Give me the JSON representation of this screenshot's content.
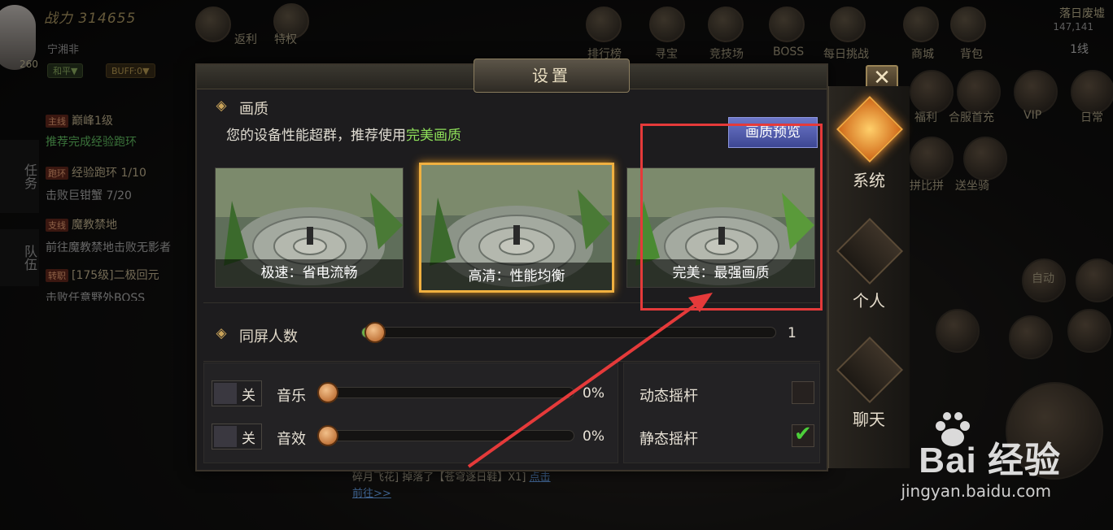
{
  "background_hud": {
    "power": "战力 314655",
    "player_name": "宁湘非",
    "level": "260",
    "pill_mode": "和平▼",
    "pill_buff": "BUFF:0▼",
    "top_icons": [
      "返利",
      "特权",
      "排行榜",
      "寻宝",
      "竞技场",
      "BOSS",
      "每日挑战",
      "商城",
      "背包"
    ],
    "vip_label": "VIP",
    "second_row": [
      "福利",
      "合服首充",
      "VIP",
      "日常"
    ],
    "third_row": [
      "拼比拼",
      "送坐骑"
    ],
    "map_name": "落日废墟",
    "map_coord": "147,141",
    "map_line": "1线",
    "auto_label": "自动"
  },
  "task_panel": {
    "tab_task": "任务",
    "tab_team": "队伍",
    "quests": [
      {
        "tag": "主线",
        "text": "巅峰1级"
      },
      {
        "tag": "",
        "text": "推荐完成经验跑环"
      },
      {
        "tag": "跑环",
        "text": "经验跑环 1/10"
      },
      {
        "tag": "",
        "text": "击败巨钳蟹    7/20"
      },
      {
        "tag": "支线",
        "text": "魔教禁地"
      },
      {
        "tag": "",
        "text": "前往魔教禁地击败无影者"
      },
      {
        "tag": "转职",
        "text": "[175级]二极回元"
      },
      {
        "tag": "",
        "text": "击败任意野外BOSS"
      }
    ]
  },
  "chat": {
    "line1": "碎月飞花] 掉落了【苍穹逐日鞋】X1]",
    "link1": "点击",
    "link2": "前往>>"
  },
  "dialog": {
    "title": "设置",
    "close": "✕",
    "quality": {
      "section_title": "画质",
      "hint_prefix": "您的设备性能超群，推荐使用",
      "hint_highlight": "完美画质",
      "preview_button": "画质预览",
      "options": [
        {
          "caption": "极速：省电流畅",
          "selected": false
        },
        {
          "caption": "高清：性能均衡",
          "selected": true
        },
        {
          "caption": "完美：最强画质",
          "selected": false
        }
      ]
    },
    "players": {
      "section_title": "同屏人数",
      "value": "1",
      "level": 0.02
    },
    "audio": {
      "music": {
        "toggle": "关",
        "label": "音乐",
        "value": "0%",
        "level": 0
      },
      "sfx": {
        "toggle": "关",
        "label": "音效",
        "value": "0%",
        "level": 0
      }
    },
    "joystick": {
      "dynamic": {
        "label": "动态摇杆",
        "checked": false
      },
      "static": {
        "label": "静态摇杆",
        "checked": true,
        "mark": "✔"
      }
    },
    "tabs": [
      {
        "label": "系统",
        "selected": true
      },
      {
        "label": "个人",
        "selected": false
      },
      {
        "label": "聊天",
        "selected": false
      }
    ]
  },
  "watermark": {
    "brand": "Bai  经验",
    "url": "jingyan.baidu.com"
  },
  "colors": {
    "accent_gold": "#f0b040",
    "highlight_green": "#8ee05a",
    "annotation_red": "#e53a3a",
    "preview_button": "#5560b8"
  }
}
